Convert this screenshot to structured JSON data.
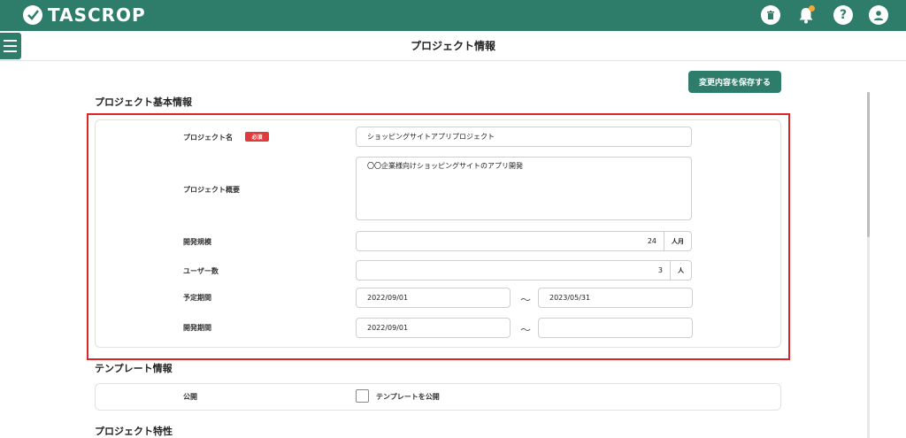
{
  "app": {
    "name": "TASCROP"
  },
  "topbar": {
    "icons": [
      "trash-icon",
      "bell-icon",
      "help-icon",
      "user-icon"
    ],
    "help_glyph": "?",
    "accent": "#2e7d6b",
    "notification_color": "#f2a93b"
  },
  "header": {
    "title": "プロジェクト情報"
  },
  "actions": {
    "save_label": "変更内容を保存する"
  },
  "basic_info": {
    "title": "プロジェクト基本情報",
    "required_badge": "必須",
    "fields": {
      "name": {
        "label": "プロジェクト名",
        "value": "ショッピングサイトアプリプロジェクト"
      },
      "summary": {
        "label": "プロジェクト概要",
        "value": "〇〇企業様向けショッピングサイトのアプリ開発"
      },
      "dev_scale": {
        "label": "開発規模",
        "value": "24",
        "unit": "人月"
      },
      "users": {
        "label": "ユーザー数",
        "value": "3",
        "unit": "人"
      },
      "planned_period": {
        "label": "予定期間",
        "start": "2022/09/01",
        "end": "2023/05/31"
      },
      "dev_period": {
        "label": "開発期間",
        "start": "2022/09/01",
        "end": ""
      }
    },
    "range_separator": "～"
  },
  "template_info": {
    "title": "テンプレート情報",
    "public_label": "公開",
    "checkbox_label": "テンプレートを公開",
    "checkbox_checked": false
  },
  "characteristics": {
    "title": "プロジェクト特性"
  },
  "highlight_color": "#e02424"
}
